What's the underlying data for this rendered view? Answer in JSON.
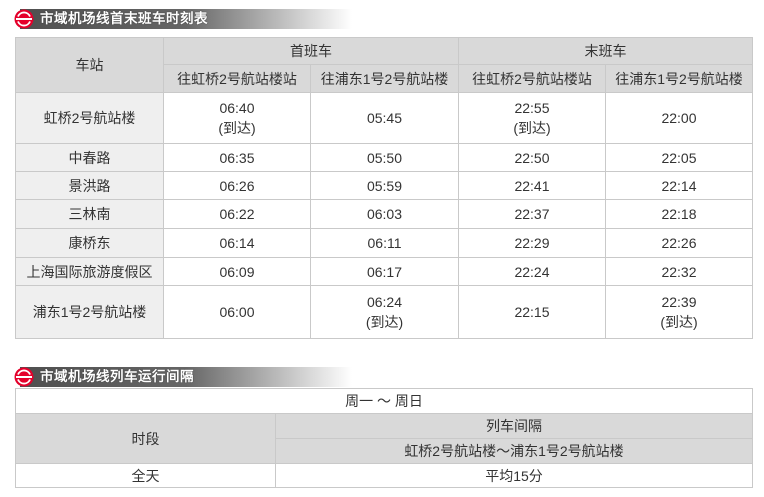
{
  "schedule": {
    "title": "市域机场线首末班车时刻表",
    "header": {
      "station": "车站",
      "first_train": "首班车",
      "last_train": "末班车",
      "directions": [
        "往虹桥2号航站楼站",
        "往浦东1号2号航站楼",
        "往虹桥2号航站楼站",
        "往浦东1号2号航站楼"
      ]
    },
    "rows": [
      {
        "station": "虹桥2号航站楼",
        "times": [
          {
            "time": "06:40",
            "note": "(到达)"
          },
          {
            "time": "05:45"
          },
          {
            "time": "22:55",
            "note": "(到达)"
          },
          {
            "time": "22:00"
          }
        ]
      },
      {
        "station": "中春路",
        "times": [
          {
            "time": "06:35"
          },
          {
            "time": "05:50"
          },
          {
            "time": "22:50"
          },
          {
            "time": "22:05"
          }
        ]
      },
      {
        "station": "景洪路",
        "times": [
          {
            "time": "06:26"
          },
          {
            "time": "05:59"
          },
          {
            "time": "22:41"
          },
          {
            "time": "22:14"
          }
        ]
      },
      {
        "station": "三林南",
        "times": [
          {
            "time": "06:22"
          },
          {
            "time": "06:03"
          },
          {
            "time": "22:37"
          },
          {
            "time": "22:18"
          }
        ]
      },
      {
        "station": "康桥东",
        "times": [
          {
            "time": "06:14"
          },
          {
            "time": "06:11"
          },
          {
            "time": "22:29"
          },
          {
            "time": "22:26"
          }
        ]
      },
      {
        "station": "上海国际旅游度假区",
        "times": [
          {
            "time": "06:09"
          },
          {
            "time": "06:17"
          },
          {
            "time": "22:24"
          },
          {
            "time": "22:32"
          }
        ]
      },
      {
        "station": "浦东1号2号航站楼",
        "times": [
          {
            "time": "06:00"
          },
          {
            "time": "06:24",
            "note": "(到达)"
          },
          {
            "time": "22:15"
          },
          {
            "time": "22:39",
            "note": "(到达)"
          }
        ]
      }
    ]
  },
  "interval": {
    "title": "市域机场线列车运行间隔",
    "days": "周一 ～ 周日",
    "period_header": "时段",
    "interval_header": "列车间隔",
    "route": "虹桥2号航站楼～浦东1号2号航站楼",
    "rows": [
      {
        "period": "全天",
        "interval": "平均15分"
      }
    ]
  },
  "icons": {
    "section_logo": "shanghai-metro-logo-icon"
  },
  "colors": {
    "logo_red": "#e4002b",
    "header_bg": "#d9d9d9",
    "station_bg": "#efefef",
    "bar_dark": "#4f4f4f"
  }
}
